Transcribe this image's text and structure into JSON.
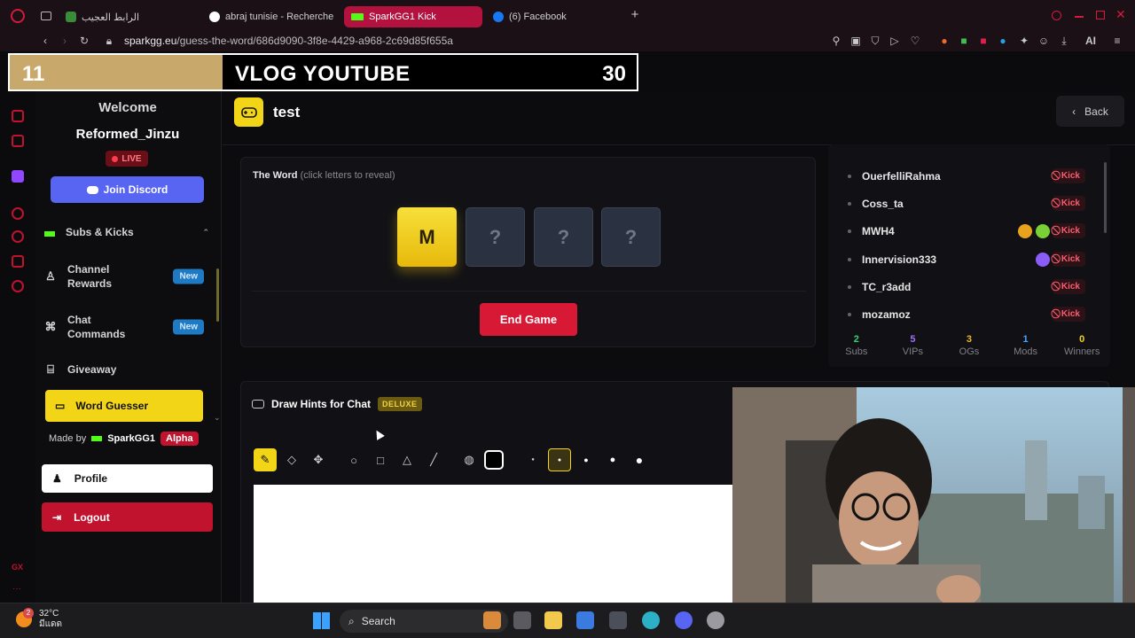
{
  "browser": {
    "tabs": [
      {
        "label": "الرابط العجيب"
      },
      {
        "label": "abraj tunisie - Recherche"
      },
      {
        "label": "SparkGG1 Kick"
      },
      {
        "label": "(6) Facebook"
      }
    ],
    "url_domain": "sparkgg.eu",
    "url_path": "/guess-the-word/686d9090-3f8e-4429-a968-2c69d85f655a",
    "ai_label": "AI"
  },
  "overlay": {
    "left_number": "11",
    "title": "VLOG YOUTUBE",
    "right_number": "30",
    "progress": 0.34
  },
  "sidebar": {
    "welcome": "Welcome",
    "username": "Reformed_Jinzu",
    "live": "LIVE",
    "discord_button": "Join Discord",
    "items": [
      {
        "label": "Subs & Kicks",
        "icon": "kick-icon"
      },
      {
        "label": "Channel\nRewards",
        "icon": "reward-icon",
        "badge": "New"
      },
      {
        "label": "Chat\nCommands",
        "icon": "command-icon",
        "badge": "New"
      },
      {
        "label": "Giveaway",
        "icon": "gift-icon"
      }
    ],
    "active_item": "Word Guesser",
    "made_by": "Made by",
    "brand": "SparkGG1",
    "alpha": "Alpha",
    "profile": "Profile",
    "logout": "Logout"
  },
  "main": {
    "game_title": "test",
    "back": "Back",
    "word_label": "The Word",
    "word_hint": "(click letters to reveal)",
    "tiles": [
      "M",
      "?",
      "?",
      "?"
    ],
    "end_game": "End Game",
    "users": [
      {
        "name": "OuerfelliRahma",
        "badges": []
      },
      {
        "name": "Coss_ta",
        "badges": []
      },
      {
        "name": "MWH4",
        "badges": [
          "#e8a21c",
          "#7ad136"
        ]
      },
      {
        "name": "Innervision333",
        "badges": [
          "#8b5cf6"
        ]
      },
      {
        "name": "TC_r3add",
        "badges": []
      },
      {
        "name": "mozamoz",
        "badges": []
      }
    ],
    "kick_label": "Kick",
    "stats": [
      {
        "value": "2",
        "label": "Subs",
        "color": "#3ad07a"
      },
      {
        "value": "5",
        "label": "VIPs",
        "color": "#a36bff"
      },
      {
        "value": "3",
        "label": "OGs",
        "color": "#f0b429"
      },
      {
        "value": "1",
        "label": "Mods",
        "color": "#4aa3ff"
      },
      {
        "value": "0",
        "label": "Winners",
        "color": "#f2d516"
      }
    ],
    "draw_title": "Draw Hints for Chat",
    "deluxe": "DELUXE"
  },
  "taskbar": {
    "temperature": "32°C",
    "weather_text": "มีแดด",
    "search": "Search",
    "weather_badge": "2"
  },
  "colors": {
    "accent_yellow": "#f2d516",
    "danger_red": "#c1122e",
    "discord": "#5865f2"
  }
}
